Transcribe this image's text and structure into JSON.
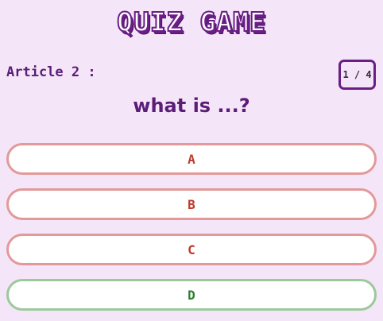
{
  "header": {
    "title": "QUIZ GAME"
  },
  "article": {
    "label": "Article 2 :"
  },
  "progress": {
    "text": "1 / 4",
    "current": 1,
    "total": 4
  },
  "question": {
    "text": "what is ...?"
  },
  "answers": [
    {
      "label": "A",
      "state": "wrong"
    },
    {
      "label": "B",
      "state": "wrong"
    },
    {
      "label": "C",
      "state": "wrong"
    },
    {
      "label": "D",
      "state": "correct"
    }
  ],
  "colors": {
    "background": "#f4e6f8",
    "primary": "#6a1e86",
    "wrong_border": "#e39999",
    "wrong_text": "#c0392b",
    "correct_border": "#9cc99c",
    "correct_text": "#2e7d32"
  }
}
